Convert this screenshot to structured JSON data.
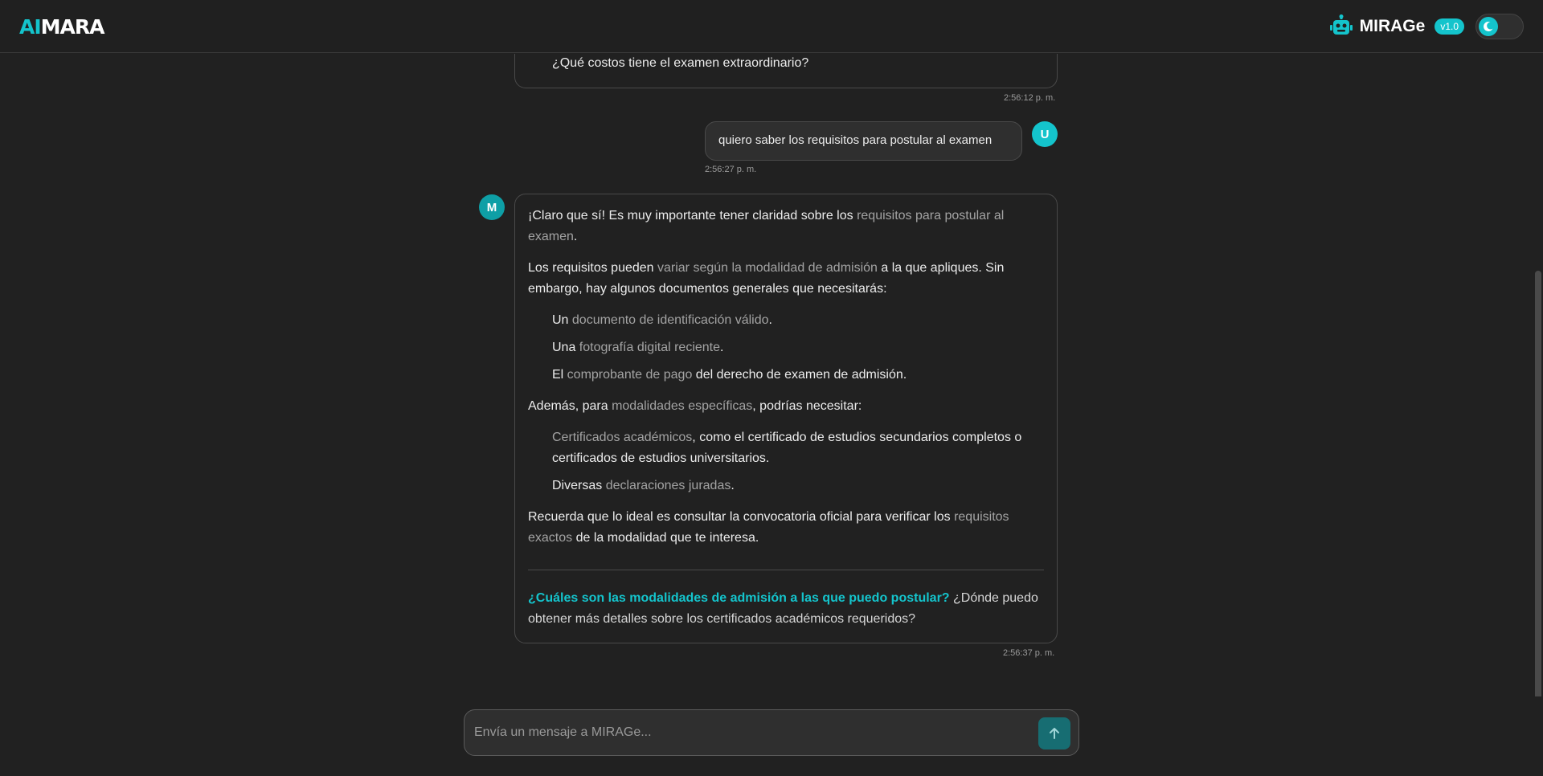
{
  "header": {
    "logo_ai": "AI",
    "logo_rest": "MARA",
    "brand_name": "MIRAGe",
    "version": "v1.0"
  },
  "messages": {
    "prev_bot_tail": "¿Qué costos tiene el examen extraordinario?",
    "prev_bot_time": "2:56:12 p. m.",
    "user_text": "quiero saber los requisitos para postular al examen",
    "user_avatar": "U",
    "user_time": "2:56:27 p. m.",
    "bot_avatar": "M",
    "bot_time": "2:56:37 p. m.",
    "bot": {
      "p1_a": "¡Claro que sí! Es muy importante tener claridad sobre los ",
      "p1_b": "requisitos para postular al examen",
      "p1_c": ".",
      "p2_a": "Los requisitos pueden ",
      "p2_b": "variar según la modalidad de admisión",
      "p2_c": " a la que apliques. Sin embargo, hay algunos documentos generales que necesitarás:",
      "list1": [
        {
          "a": "Un ",
          "b": "documento de identificación válido",
          "c": "."
        },
        {
          "a": "Una ",
          "b": "fotografía digital reciente",
          "c": "."
        },
        {
          "a": "El ",
          "b": "comprobante de pago",
          "c": " del derecho de examen de admisión."
        }
      ],
      "p3_a": "Además, para ",
      "p3_b": "modalidades específicas",
      "p3_c": ", podrías necesitar:",
      "list2": [
        {
          "a": "",
          "b": "Certificados académicos",
          "c": ", como el certificado de estudios secundarios completos o certificados de estudios universitarios."
        },
        {
          "a": "Diversas ",
          "b": "declaraciones juradas",
          "c": "."
        }
      ],
      "p4_a": "Recuerda que lo ideal es consultar la convocatoria oficial para verificar los ",
      "p4_b": "requisitos exactos",
      "p4_c": " de la modalidad que te interesa.",
      "suggestion_1": "¿Cuáles son las modalidades de admisión a las que puedo postular?",
      "suggestion_2": " ¿Dónde puedo obtener más detalles sobre los certificados académicos requeridos?"
    }
  },
  "composer": {
    "placeholder": "Envía un mensaje a MIRAGe..."
  },
  "icons": {
    "robot": "robot-icon",
    "theme": "moon-icon",
    "send": "arrow-up-icon"
  },
  "colors": {
    "accent": "#14c4cc",
    "background": "#212121"
  }
}
